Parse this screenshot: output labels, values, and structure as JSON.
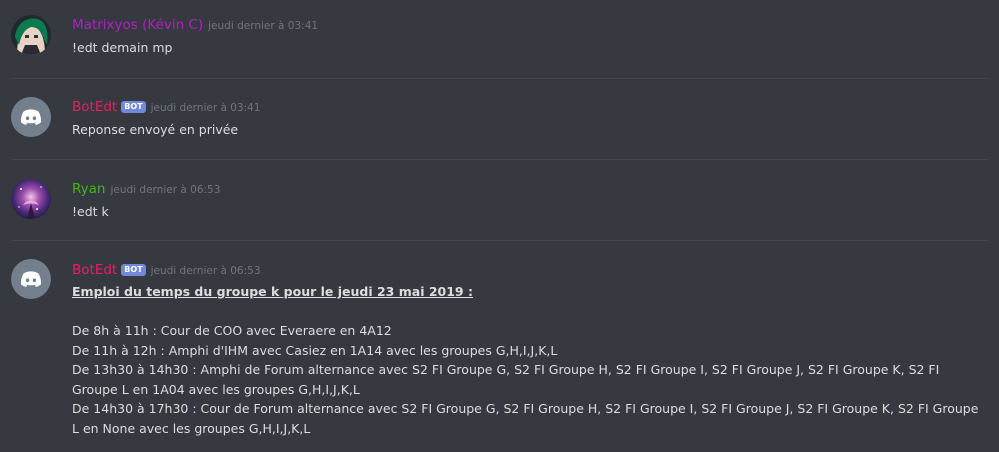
{
  "messages": [
    {
      "author": "Matrixyos (Kévin C)",
      "author_color": "#b61cc9",
      "timestamp": "jeudi dernier à 03:41",
      "text": "!edt demain mp",
      "avatar": "anime-avatar"
    },
    {
      "author": "BotEdt",
      "author_color": "#e91e63",
      "bot_tag": "BOT",
      "timestamp": "jeudi dernier à 03:41",
      "text": "Reponse envoyé en privée",
      "avatar": "discord-logo-icon"
    },
    {
      "author": "Ryan",
      "author_color": "#3fb81a",
      "timestamp": "jeudi dernier à 06:53",
      "text": "!edt k",
      "avatar": "galaxy-avatar"
    },
    {
      "author": "BotEdt",
      "author_color": "#e91e63",
      "bot_tag": "BOT",
      "timestamp": "jeudi dernier à 06:53",
      "heading": "Emploi du temps du groupe k pour le jeudi 23 mai 2019 :",
      "lines": [
        "De 8h à 11h : Cour de COO avec Everaere en 4A12",
        "De 11h à 12h : Amphi d'IHM avec Casiez en 1A14 avec les groupes G,H,I,J,K,L",
        "De 13h30 à 14h30 : Amphi de Forum alternance avec S2 FI Groupe G, S2 FI Groupe H, S2 FI Groupe I, S2 FI Groupe J, S2 FI Groupe K, S2 FI Groupe L en 1A04 avec les groupes G,H,I,J,K,L",
        "De 14h30 à 17h30 : Cour de Forum alternance avec S2 FI Groupe G, S2 FI Groupe H, S2 FI Groupe I, S2 FI Groupe J, S2 FI Groupe K, S2 FI Groupe L en None avec les groupes G,H,I,J,K,L"
      ],
      "avatar": "discord-logo-icon"
    }
  ]
}
